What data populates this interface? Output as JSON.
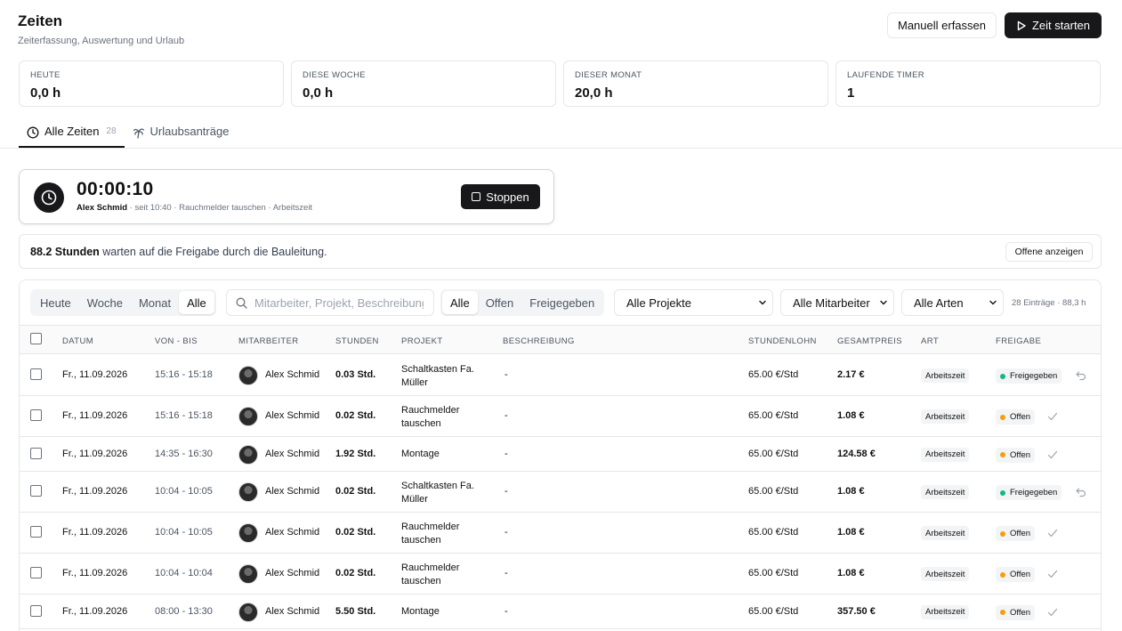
{
  "header": {
    "title": "Zeiten",
    "subtitle": "Zeiterfassung, Auswertung und Urlaub",
    "manual_label": "Manuell erfassen",
    "start_label": "Zeit starten"
  },
  "stats": [
    {
      "label": "HEUTE",
      "value": "0,0 h"
    },
    {
      "label": "DIESE WOCHE",
      "value": "0,0 h"
    },
    {
      "label": "DIESER MONAT",
      "value": "20,0 h"
    },
    {
      "label": "LAUFENDE TIMER",
      "value": "1"
    }
  ],
  "tabs": [
    {
      "label": "Alle Zeiten",
      "count": "28",
      "icon": "clock-icon"
    },
    {
      "label": "Urlaubsanträge",
      "icon": "palm-tree-icon"
    }
  ],
  "timer": {
    "time": "00:00:10",
    "user": "Alex Schmid",
    "meta": " · seit 10:40 · Rauchmelder tauschen · Arbeitszeit",
    "stop_label": "Stoppen"
  },
  "banner": {
    "hours": "88.2 Stunden",
    "text": " warten auf die Freigabe durch die Bauleitung.",
    "button": "Offene anzeigen"
  },
  "filters": {
    "range": [
      "Heute",
      "Woche",
      "Monat",
      "Alle"
    ],
    "range_active": "Alle",
    "search_placeholder": "Mitarbeiter, Projekt, Beschreibung",
    "status": [
      "Alle",
      "Offen",
      "Freigegeben"
    ],
    "status_active": "Alle",
    "project": "Alle Projekte",
    "employee": "Alle Mitarbeiter",
    "kind": "Alle Arten",
    "summary": "28 Einträge · 88,3 h"
  },
  "columns": [
    "DATUM",
    "VON - BIS",
    "MITARBEITER",
    "STUNDEN",
    "PROJEKT",
    "BESCHREIBUNG",
    "STUNDENLOHN",
    "GESAMTPREIS",
    "ART",
    "FREIGABE"
  ],
  "rows": [
    {
      "date": "Fr., 11.09.2026",
      "time": "15:16 - 15:18",
      "employee": "Alex Schmid",
      "hours": "0.03 Std.",
      "project": [
        "Schaltkasten Fa.",
        "Müller"
      ],
      "description": "-",
      "rate": "65.00 €/Std",
      "total": "2.17 €",
      "kind": "Arbeitszeit",
      "status": "Freigegeben"
    },
    {
      "date": "Fr., 11.09.2026",
      "time": "15:16 - 15:18",
      "employee": "Alex Schmid",
      "hours": "0.02 Std.",
      "project": [
        "Rauchmelder",
        "tauschen"
      ],
      "description": "-",
      "rate": "65.00 €/Std",
      "total": "1.08 €",
      "kind": "Arbeitszeit",
      "status": "Offen"
    },
    {
      "date": "Fr., 11.09.2026",
      "time": "14:35 - 16:30",
      "employee": "Alex Schmid",
      "hours": "1.92 Std.",
      "project": [
        "Montage"
      ],
      "description": "-",
      "rate": "65.00 €/Std",
      "total": "124.58 €",
      "kind": "Arbeitszeit",
      "status": "Offen"
    },
    {
      "date": "Fr., 11.09.2026",
      "time": "10:04 - 10:05",
      "employee": "Alex Schmid",
      "hours": "0.02 Std.",
      "project": [
        "Schaltkasten Fa.",
        "Müller"
      ],
      "description": "-",
      "rate": "65.00 €/Std",
      "total": "1.08 €",
      "kind": "Arbeitszeit",
      "status": "Freigegeben"
    },
    {
      "date": "Fr., 11.09.2026",
      "time": "10:04 - 10:05",
      "employee": "Alex Schmid",
      "hours": "0.02 Std.",
      "project": [
        "Rauchmelder",
        "tauschen"
      ],
      "description": "-",
      "rate": "65.00 €/Std",
      "total": "1.08 €",
      "kind": "Arbeitszeit",
      "status": "Offen"
    },
    {
      "date": "Fr., 11.09.2026",
      "time": "10:04 - 10:04",
      "employee": "Alex Schmid",
      "hours": "0.02 Std.",
      "project": [
        "Rauchmelder",
        "tauschen"
      ],
      "description": "-",
      "rate": "65.00 €/Std",
      "total": "1.08 €",
      "kind": "Arbeitszeit",
      "status": "Offen"
    },
    {
      "date": "Fr., 11.09.2026",
      "time": "08:00 - 13:30",
      "employee": "Alex Schmid",
      "hours": "5.50 Std.",
      "project": [
        "Montage"
      ],
      "description": "-",
      "rate": "65.00 €/Std",
      "total": "357.50 €",
      "kind": "Arbeitszeit",
      "status": "Offen"
    }
  ],
  "colors": {
    "approved": "#10b981",
    "open": "#f59e0b",
    "primary": "#18181b"
  }
}
